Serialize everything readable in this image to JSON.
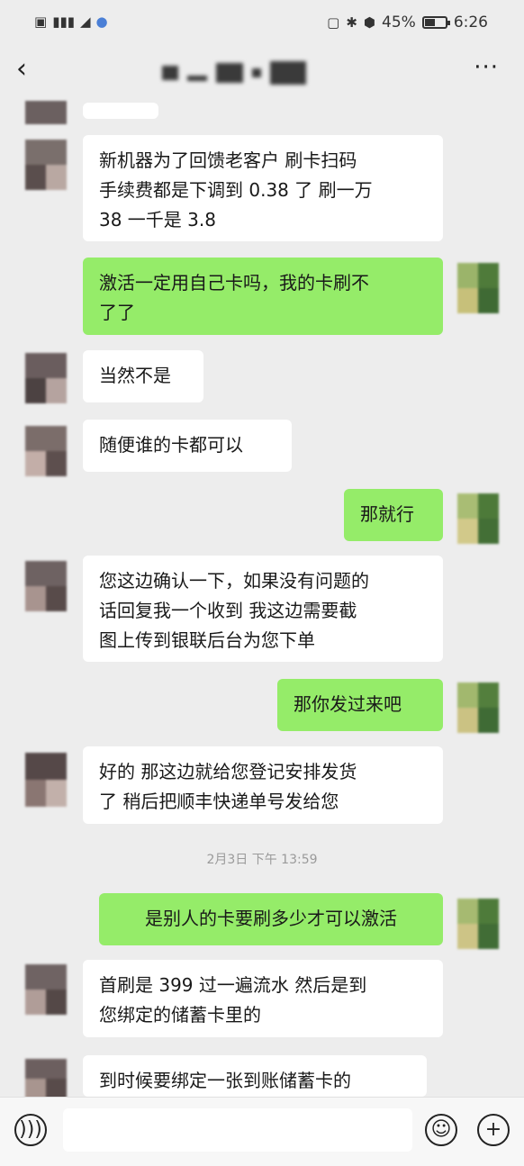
{
  "status_bar": {
    "battery": "45%",
    "time": "6:26",
    "left_icons": [
      "sim-icon",
      "signal-icon",
      "send-icon",
      "dot-icon"
    ]
  },
  "nav": {
    "contact_name": "",
    "back_icon": "back-icon",
    "more_icon": "more-icon"
  },
  "messages": [
    {
      "side": "left",
      "text": "新机器为了回馈老客户  刷卡扫码\n手续费都是下调到 0.38 了  刷一万\n38  一千是 3.8"
    },
    {
      "side": "right",
      "text": "激活一定用自己卡吗，我的卡刷不\n了了"
    },
    {
      "side": "left",
      "text": "当然不是"
    },
    {
      "side": "left",
      "text": "随便谁的卡都可以"
    },
    {
      "side": "right",
      "text": "那就行"
    },
    {
      "side": "left",
      "text": "您这边确认一下，如果没有问题的\n话回复我一个收到  我这边需要截\n图上传到银联后台为您下单"
    },
    {
      "side": "right",
      "text": "那你发过来吧"
    },
    {
      "side": "left",
      "text": "好的  那这边就给您登记安排发货\n了 稍后把顺丰快递单号发给您"
    },
    {
      "side": "right",
      "text": "是别人的卡要刷多少才可以激活"
    },
    {
      "side": "left",
      "text": "首刷是 399 过一遍流水  然后是到\n您绑定的储蓄卡里的"
    },
    {
      "side": "left",
      "text": "到时候要绑定一张到账储蓄卡的"
    }
  ],
  "timestamp": "2月3日 下午 13:59",
  "input_bar": {
    "voice_icon": "voice-icon",
    "emoji_icon": "emoji-icon",
    "plus_icon": "plus-icon",
    "input_value": ""
  },
  "colors": {
    "background": "#ededed",
    "incoming_bubble": "#ffffff",
    "outgoing_bubble": "#95ec69"
  }
}
